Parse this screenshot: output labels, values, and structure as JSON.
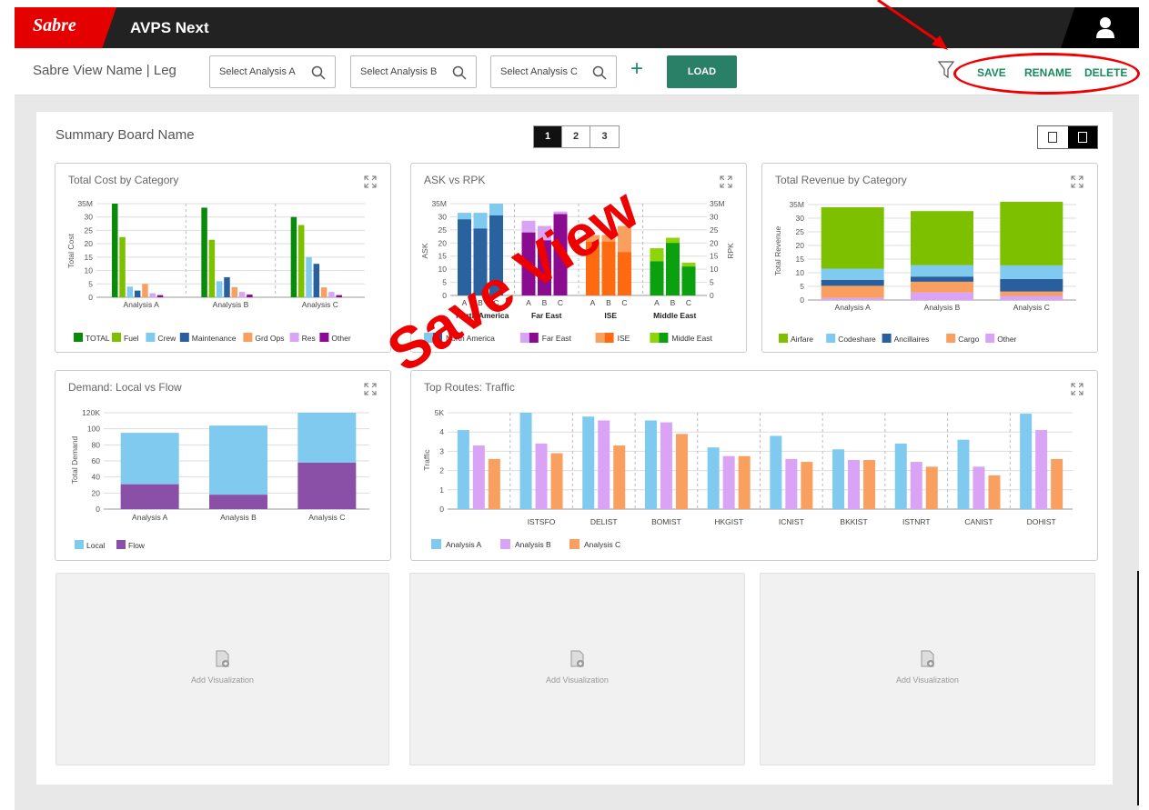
{
  "header": {
    "brand": "Sabre",
    "app_title": "AVPS Next"
  },
  "toolbar": {
    "view_name": "Sabre View Name | Leg",
    "selects": [
      "Select Analysis A",
      "Select Analysis B",
      "Select Analysis C"
    ],
    "add_label": "+",
    "load_label": "LOAD",
    "actions": {
      "save": "SAVE",
      "rename": "RENAME",
      "delete": "DELETE"
    }
  },
  "board": {
    "title": "Summary Board Name",
    "pages": [
      "1",
      "2",
      "3"
    ],
    "active_page": "1"
  },
  "panels": {
    "cost": {
      "title": "Total Cost by Category"
    },
    "ask": {
      "title": "ASK vs RPK"
    },
    "revenue": {
      "title": "Total Revenue by Category"
    },
    "demand": {
      "title": "Demand: Local vs Flow"
    },
    "routes": {
      "title": "Top Routes: Traffic"
    }
  },
  "empty_slots": [
    {
      "label": "Add Visualization"
    },
    {
      "label": "Add Visualization"
    },
    {
      "label": "Add Visualization"
    }
  ],
  "annotation": {
    "text": "Save View",
    "color": "#e00000"
  },
  "colors": {
    "brand": "#e50000",
    "accent": "#2a7f67",
    "action": "#1a8a5e"
  },
  "chart_data": [
    {
      "id": "cost",
      "type": "bar",
      "ylabel": "Total Cost",
      "yticks": [
        "0",
        "5",
        "10",
        "15",
        "20",
        "25",
        "30",
        "35M"
      ],
      "ylim": [
        0,
        35
      ],
      "categories": [
        "Analysis  A",
        "Analysis B",
        "Analysis C"
      ],
      "series": [
        {
          "name": "TOTAL",
          "color": "#0a8a0a",
          "values": [
            35,
            33.5,
            30
          ]
        },
        {
          "name": "Fuel",
          "color": "#7cc000",
          "values": [
            22.5,
            21.5,
            27
          ]
        },
        {
          "name": "Crew",
          "color": "#7fcaee",
          "values": [
            4,
            6,
            15
          ]
        },
        {
          "name": "Maintenance",
          "color": "#2a5f9e",
          "values": [
            2.5,
            7.5,
            12.5
          ]
        },
        {
          "name": "Grd Ops",
          "color": "#f9a060",
          "values": [
            5,
            3.8,
            3.7
          ]
        },
        {
          "name": "Res",
          "color": "#d9a4f5",
          "values": [
            1.5,
            2,
            2
          ]
        },
        {
          "name": "Other",
          "color": "#8a0a96",
          "values": [
            0.8,
            1,
            0.8
          ]
        }
      ]
    },
    {
      "id": "ask",
      "type": "bar",
      "ylabel": "ASK",
      "y2label": "RPK",
      "yticks": [
        "0",
        "5",
        "10",
        "15",
        "20",
        "25",
        "30",
        "35M"
      ],
      "ylim": [
        0,
        35
      ],
      "groups": [
        {
          "name": "North America",
          "light": "#7fcaee",
          "dark": "#2a62a0",
          "rpk": [
            29,
            25.5,
            30.5
          ],
          "ask": [
            31.5,
            31.5,
            35
          ]
        },
        {
          "name": "Far East",
          "light": "#d9a4f5",
          "dark": "#8a0a90",
          "rpk": [
            24,
            21,
            31
          ],
          "ask": [
            28.5,
            26.5,
            32
          ]
        },
        {
          "name": "ISE",
          "light": "#f9a060",
          "dark": "#ff6a10",
          "rpk": [
            20.5,
            20.5,
            16.5
          ],
          "ask": [
            23,
            23,
            26.5
          ]
        },
        {
          "name": "Middle East",
          "light": "#8ed40a",
          "dark": "#0aa010",
          "rpk": [
            13,
            20,
            11
          ],
          "ask": [
            18,
            22,
            12.5
          ]
        }
      ],
      "bar_labels": [
        "A",
        "B",
        "C"
      ]
    },
    {
      "id": "revenue",
      "type": "bar",
      "stacked": true,
      "ylabel": "Total Revenue",
      "yticks": [
        "0",
        "5",
        "10",
        "15",
        "20",
        "25",
        "30",
        "35M"
      ],
      "ylim": [
        0,
        35
      ],
      "categories": [
        "Analysis  A",
        "Analysis B",
        "Analysis C"
      ],
      "series": [
        {
          "name": "Other",
          "color": "#d9a4f5",
          "values": [
            0.8,
            2.8,
            1.5
          ]
        },
        {
          "name": "Cargo",
          "color": "#f9a060",
          "values": [
            4.4,
            3.9,
            1.6
          ]
        },
        {
          "name": "Ancillaires",
          "color": "#2a5f9e",
          "values": [
            2.2,
            1.9,
            4.6
          ]
        },
        {
          "name": "Codeshare",
          "color": "#7fcaee",
          "values": [
            4.1,
            4.2,
            5
          ]
        },
        {
          "name": "Airfare",
          "color": "#7cc000",
          "values": [
            22.5,
            19.8,
            23.3
          ]
        }
      ],
      "legend_order": [
        "Airfare",
        "Codeshare",
        "Ancillaires",
        "Cargo",
        "Other"
      ]
    },
    {
      "id": "demand",
      "type": "bar",
      "stacked": true,
      "ylabel": "Total Demand",
      "yticks": [
        "0",
        "20",
        "40",
        "60",
        "80",
        "100",
        "120K"
      ],
      "ylim": [
        0,
        120
      ],
      "categories": [
        "Analysis  A",
        "Analysis B",
        "Analysis C"
      ],
      "series": [
        {
          "name": "Flow",
          "color": "#8a4fa6",
          "values": [
            31,
            18,
            58
          ]
        },
        {
          "name": "Local",
          "color": "#7fcaee",
          "values": [
            64,
            86,
            62
          ]
        }
      ],
      "legend_order": [
        "Local",
        "Flow"
      ]
    },
    {
      "id": "routes",
      "type": "bar",
      "ylabel": "Traffic",
      "yticks": [
        "0",
        "1",
        "2",
        "3",
        "4",
        "5K"
      ],
      "ylim": [
        0,
        5
      ],
      "categories": [
        "",
        "ISTSFO",
        "DELIST",
        "BOMIST",
        "HKGIST",
        "ICNIST",
        "BKKIST",
        "ISTNRT",
        "CANIST",
        "DOHIST"
      ],
      "series": [
        {
          "name": "Analysis A",
          "color": "#7fcaee",
          "values": [
            4.1,
            5,
            4.8,
            4.6,
            3.2,
            3.8,
            3.1,
            3.4,
            3.6,
            4.95
          ]
        },
        {
          "name": "Analysis B",
          "color": "#d9a4f5",
          "values": [
            3.3,
            3.4,
            4.6,
            4.5,
            2.75,
            2.6,
            2.55,
            2.45,
            2.2,
            4.1
          ]
        },
        {
          "name": "Analysis C",
          "color": "#f9a060",
          "values": [
            2.6,
            2.9,
            3.3,
            3.9,
            2.75,
            2.45,
            2.55,
            2.2,
            1.75,
            2.6
          ]
        }
      ],
      "legend_names": [
        "Analysis A",
        "Analysis B",
        "Analysis C"
      ]
    }
  ]
}
